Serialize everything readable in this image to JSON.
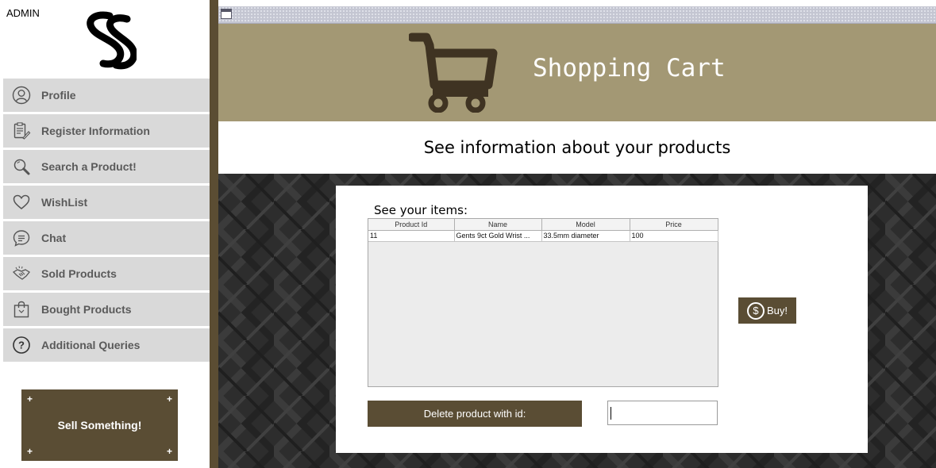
{
  "sidebar": {
    "admin_label": "ADMIN",
    "logo_icon": "ss-logo",
    "items": [
      {
        "label": "Profile",
        "icon": "user-icon"
      },
      {
        "label": "Register Information",
        "icon": "clipboard-edit-icon"
      },
      {
        "label": "Search a Product!",
        "icon": "magnifier-icon"
      },
      {
        "label": "WishList",
        "icon": "heart-icon"
      },
      {
        "label": "Chat",
        "icon": "chat-bubble-icon"
      },
      {
        "label": "Sold Products",
        "icon": "handshake-icon"
      },
      {
        "label": "Bought Products",
        "icon": "shopping-bag-icon"
      },
      {
        "label": "Additional Queries",
        "icon": "question-icon"
      }
    ],
    "sell_button": "Sell Something!"
  },
  "header": {
    "title": "Shopping Cart",
    "cart_icon": "shopping-cart-icon"
  },
  "info": {
    "title": "See information about your products"
  },
  "cart": {
    "items_label": "See your items:",
    "columns": [
      "Product Id",
      "Name",
      "Model",
      "Price"
    ],
    "rows": [
      [
        "11",
        "Gents 9ct Gold Wrist ...",
        "33.5mm diameter",
        "100"
      ]
    ],
    "buy_button": "Buy!",
    "buy_icon": "dollar-circle-icon",
    "delete_button": "Delete product with id:",
    "delete_input_value": ""
  },
  "colors": {
    "brand_brown": "#5a4d34",
    "header_tan": "#a39874",
    "nav_gray": "#d9d9d9",
    "background_dark": "#2e2e2e"
  }
}
